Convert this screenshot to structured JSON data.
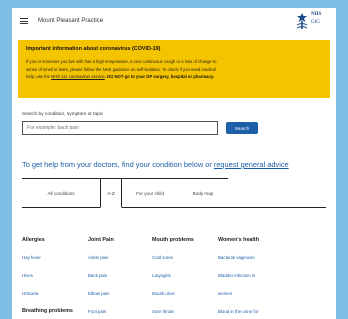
{
  "header": {
    "practice_name": "Mount Pleasant Practice",
    "logo_top": "NHS",
    "logo_bottom": "GIG"
  },
  "alert": {
    "title": "Important information about coronavirus (COVID-19)",
    "line1": "If you or someone you live with has a high temperature, a new continuous cough or a loss of change to",
    "line2": "sense of smell or taste, please follow the NHS guidance on self-isolation. To check if you need medical",
    "line3_prefix": "help, use the ",
    "line3_link": "NHS 111 coronavirus service",
    "line3_bold": ". DO NOT go to your GP surgery, hospital or pharmacy."
  },
  "search": {
    "label": "Search by condition, symptom or topic",
    "placeholder": "For example: back pain",
    "button": "Search"
  },
  "help": {
    "prefix": "To get help from your doctors, find your condition below or ",
    "link": "request general advice"
  },
  "tabs": [
    {
      "label": "All conditions",
      "active": false
    },
    {
      "label": "A-Z",
      "active": true
    },
    {
      "label": "For your child",
      "active": false
    },
    {
      "label": "Body map",
      "active": false
    }
  ],
  "categories": [
    {
      "title": "Allergies",
      "items": [
        "Hay fever",
        "Hives",
        "Urticaria"
      ]
    },
    {
      "title": "Joint Pain",
      "items": [
        "Ankle pain",
        "Back pain",
        "Elbow pain",
        "Foot pain"
      ]
    },
    {
      "title": "Mouth problems",
      "items": [
        "Cold sores",
        "Laryngitis",
        "Mouth ulcer",
        "Sore throat"
      ]
    },
    {
      "title": "Women's health",
      "items": [
        "Bacterial vaginosis",
        "Bladder infection in",
        "women",
        "Blood in the urine for"
      ]
    }
  ],
  "extra_heading": "Breathing problems",
  "colors": {
    "background": "#7fbfe6",
    "alert": "#f5c400",
    "link": "#1d5fa8",
    "button": "#1d5fa8"
  }
}
